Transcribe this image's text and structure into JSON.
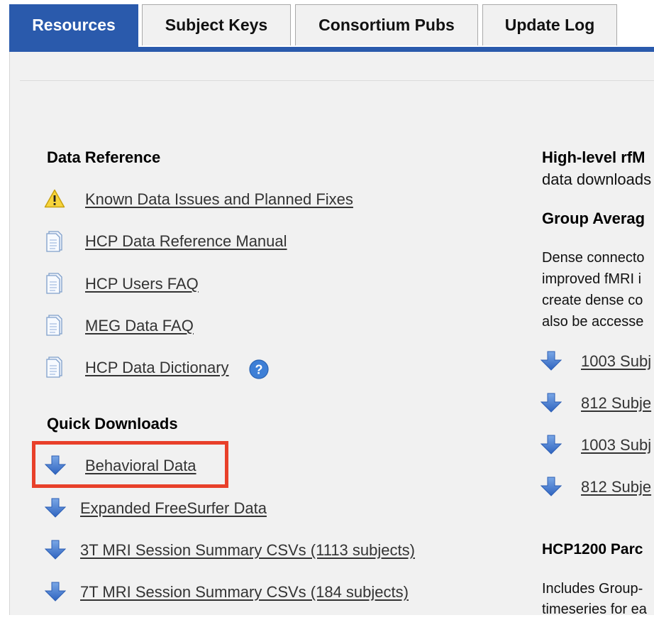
{
  "tabs": [
    {
      "label": "Resources",
      "active": true
    },
    {
      "label": "Subject Keys",
      "active": false
    },
    {
      "label": "Consortium Pubs",
      "active": false
    },
    {
      "label": "Update Log",
      "active": false
    }
  ],
  "colors": {
    "accent": "#2a5aac",
    "panel_bg": "#f1f1f1",
    "highlight": "#e8402a",
    "warning": "#f7d43c"
  },
  "left": {
    "data_reference": {
      "heading": "Data Reference",
      "items": [
        {
          "label": "Known Data Issues and Planned Fixes",
          "icon": "warning-icon"
        },
        {
          "label": "HCP Data Reference Manual",
          "icon": "document-icon"
        },
        {
          "label": "HCP Users FAQ",
          "icon": "document-icon"
        },
        {
          "label": "MEG Data FAQ",
          "icon": "document-icon"
        },
        {
          "label": "HCP Data Dictionary",
          "icon": "document-icon",
          "badge_icon": "help-icon",
          "badge_text": "?"
        }
      ]
    },
    "quick_downloads": {
      "heading": "Quick Downloads",
      "items": [
        {
          "label": "Behavioral Data",
          "icon": "download-arrow-icon",
          "highlighted": true
        },
        {
          "label": "Expanded FreeSurfer Data",
          "icon": "download-arrow-icon"
        },
        {
          "label": "3T MRI Session Summary CSVs (1113 subjects)",
          "icon": "download-arrow-icon"
        },
        {
          "label": "7T MRI Session Summary CSVs (184 subjects)",
          "icon": "download-arrow-icon"
        }
      ]
    }
  },
  "right": {
    "heading_1": "High-level rfM",
    "subtext_1": "data downloads",
    "heading_2": "Group Averag",
    "paragraph": [
      "Dense connecto",
      "improved fMRI i",
      "create dense co",
      "also be accesse"
    ],
    "downloads": [
      {
        "label": "1003 Subj",
        "icon": "download-arrow-icon"
      },
      {
        "label": "812 Subje",
        "icon": "download-arrow-icon"
      },
      {
        "label": "1003 Subj",
        "icon": "download-arrow-icon"
      },
      {
        "label": "812 Subje",
        "icon": "download-arrow-icon"
      }
    ],
    "heading_3": "HCP1200 Parc",
    "paragraph_2": [
      "Includes Group-",
      "timeseries for ea"
    ]
  }
}
